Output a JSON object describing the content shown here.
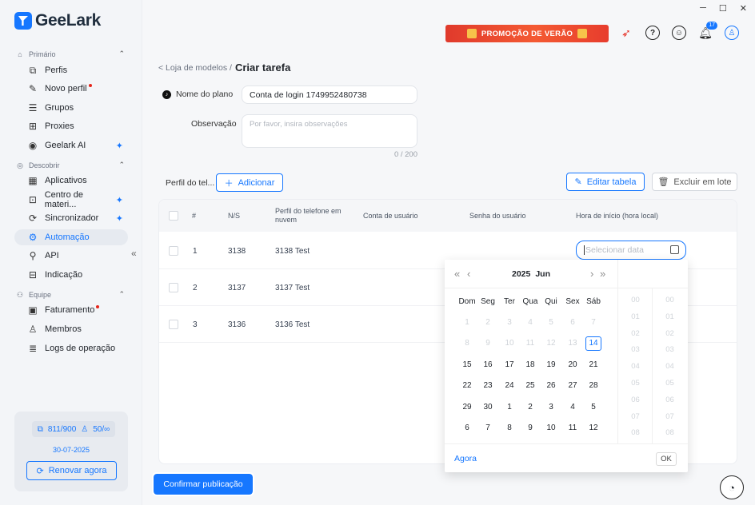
{
  "app": {
    "logo_text": "GeeLark"
  },
  "window": {
    "minimize": "─",
    "maximize": "☐",
    "close": "✕"
  },
  "promo": {
    "label": "PROMOÇÃO DE VERÃO"
  },
  "topbar": {
    "notification_count": "17"
  },
  "sidebar": {
    "section_primary": "Primário",
    "section_discover": "Descobrir",
    "section_team": "Equipe",
    "items": [
      {
        "label": "Perfis",
        "icon": "profiles-icon"
      },
      {
        "label": "Novo perfil",
        "icon": "new-profile-icon"
      },
      {
        "label": "Grupos",
        "icon": "groups-icon"
      },
      {
        "label": "Proxies",
        "icon": "proxies-icon"
      },
      {
        "label": "Geelark AI",
        "icon": "ai-icon"
      },
      {
        "label": "Aplicativos",
        "icon": "apps-icon"
      },
      {
        "label": "Centro de materi...",
        "icon": "materials-icon"
      },
      {
        "label": "Sincronizador",
        "icon": "sync-icon"
      },
      {
        "label": "Automação",
        "icon": "automation-icon"
      },
      {
        "label": "API",
        "icon": "api-icon"
      },
      {
        "label": "Indicação",
        "icon": "referral-icon"
      },
      {
        "label": "Faturamento",
        "icon": "billing-icon"
      },
      {
        "label": "Membros",
        "icon": "members-icon"
      },
      {
        "label": "Logs de operação",
        "icon": "logs-icon"
      }
    ],
    "quota": {
      "profiles": "811/900",
      "members": "50/",
      "members_unlimited": "∞",
      "expiry_date": "30-07-2025",
      "renew_label": "Renovar agora"
    }
  },
  "breadcrumb": {
    "parent": "< Loja de modelos /",
    "current": "Criar tarefa"
  },
  "form": {
    "plan_name_label": "Nome do plano",
    "plan_name_value": "Conta de login 1749952480738",
    "note_label": "Observação",
    "note_placeholder": "Por favor, insira observações",
    "note_counter": "0 / 200"
  },
  "toolbar": {
    "profile_label": "Perfil do tel...",
    "add_label": "Adicionar",
    "edit_table_label": "Editar tabela",
    "batch_delete_label": "Excluir em lote"
  },
  "table": {
    "headers": {
      "index": "#",
      "serial": "N/S",
      "phone_profile": "Perfil do telefone em nuvem",
      "user_account": "Conta de usuário",
      "user_password": "Senha do usuário",
      "start_time": "Hora de início (hora local)"
    },
    "rows": [
      {
        "index": "1",
        "serial": "3138",
        "profile": "3138 Test"
      },
      {
        "index": "2",
        "serial": "3137",
        "profile": "3137 Test"
      },
      {
        "index": "3",
        "serial": "3136",
        "profile": "3136 Test"
      }
    ],
    "date_placeholder": "Selecionar data"
  },
  "picker": {
    "year": "2025",
    "month": "Jun",
    "weekdays": [
      "Dom",
      "Seg",
      "Ter",
      "Qua",
      "Qui",
      "Sex",
      "Sáb"
    ],
    "weeks": [
      [
        "1",
        "2",
        "3",
        "4",
        "5",
        "6",
        "7"
      ],
      [
        "8",
        "9",
        "10",
        "11",
        "12",
        "13",
        "14"
      ],
      [
        "15",
        "16",
        "17",
        "18",
        "19",
        "20",
        "21"
      ],
      [
        "22",
        "23",
        "24",
        "25",
        "26",
        "27",
        "28"
      ],
      [
        "29",
        "30",
        "1",
        "2",
        "3",
        "4",
        "5"
      ],
      [
        "6",
        "7",
        "8",
        "9",
        "10",
        "11",
        "12"
      ]
    ],
    "today": "14",
    "hours": [
      "00",
      "01",
      "02",
      "03",
      "04",
      "05",
      "06",
      "07",
      "08"
    ],
    "minutes": [
      "00",
      "01",
      "02",
      "03",
      "04",
      "05",
      "06",
      "07",
      "08"
    ],
    "now_label": "Agora",
    "ok_label": "OK"
  },
  "footer": {
    "confirm_label": "Confirmar publicação"
  }
}
